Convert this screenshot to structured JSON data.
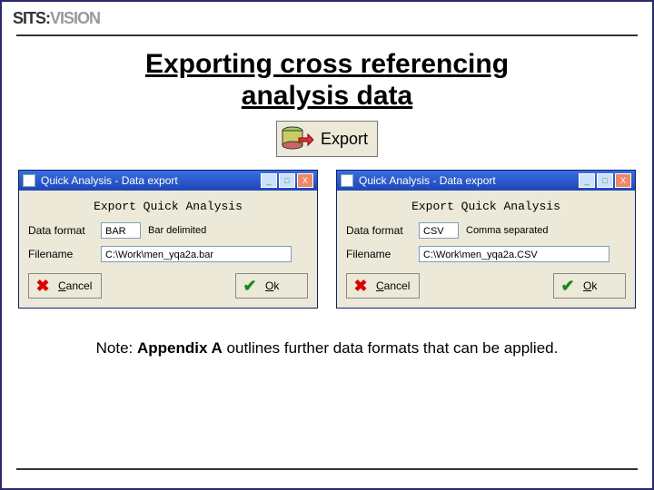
{
  "logo": {
    "left": "SITS:",
    "right": "VISION"
  },
  "title_line1": "Exporting cross referencing",
  "title_line2": "analysis data",
  "export_button_label": "Export",
  "panel": {
    "window_title": "Quick Analysis - Data export",
    "panel_title": "Export Quick Analysis",
    "labels": {
      "data_format": "Data format",
      "filename": "Filename"
    },
    "buttons": {
      "cancel": "Cancel",
      "ok": "Ok"
    }
  },
  "left": {
    "format_value": "BAR",
    "format_desc": "Bar delimited",
    "filename_value": "C:\\Work\\men_yqa2a.bar"
  },
  "right": {
    "format_value": "CSV",
    "format_desc": "Comma separated",
    "filename_value": "C:\\Work\\men_yqa2a.CSV"
  },
  "note": {
    "prefix": "Note: ",
    "bold": "Appendix A",
    "rest": " outlines further data formats that can be applied."
  },
  "titlebar_btns": {
    "min": "_",
    "max": "□",
    "close": "X"
  }
}
